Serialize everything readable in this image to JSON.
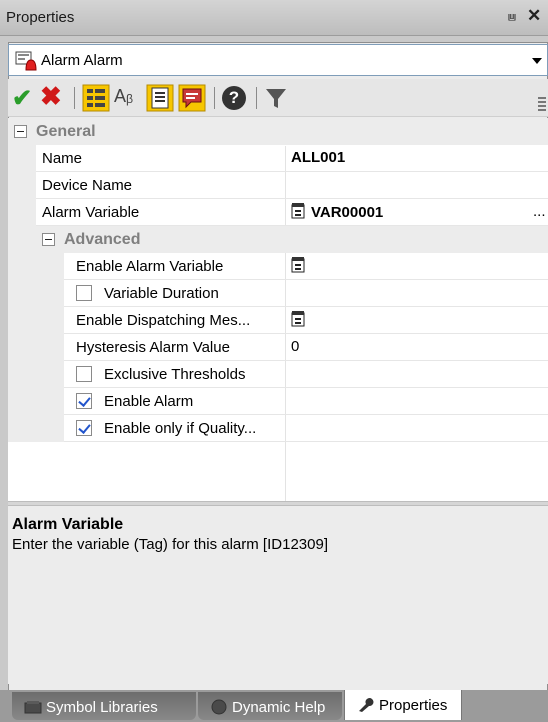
{
  "panel": {
    "title": "Properties",
    "pin_glyph": "⩏",
    "close_glyph": "✕"
  },
  "selector": {
    "value": "Alarm Alarm",
    "icon": "alarm-object-icon"
  },
  "toolbar": {
    "buttons": [
      {
        "name": "apply-icon",
        "glyph": "✔"
      },
      {
        "name": "cancel-icon",
        "glyph": "✖"
      },
      {
        "name": "categorized-icon"
      },
      {
        "name": "alphabetical-icon",
        "glyph": "Aᵦ"
      },
      {
        "name": "property-pages-icon"
      },
      {
        "name": "comment-icon"
      },
      {
        "name": "help-icon",
        "glyph": "?"
      },
      {
        "name": "filter-icon"
      }
    ]
  },
  "grid": {
    "category_general": "General",
    "name_label": "Name",
    "name_value": "ALL001",
    "device_label": "Device Name",
    "device_value": "",
    "alarm_var_label": "Alarm Variable",
    "alarm_var_value": "VAR00001",
    "alarm_var_button": "...",
    "category_advanced": "Advanced",
    "enable_var_label": "Enable Alarm Variable",
    "var_duration_label": "Variable Duration",
    "var_duration_checked": false,
    "enable_dispatch_label": "Enable Dispatching Mes...",
    "hysteresis_label": "Hysteresis Alarm Value",
    "hysteresis_value": "0",
    "exclusive_label": "Exclusive Thresholds",
    "exclusive_checked": false,
    "enable_alarm_label": "Enable Alarm",
    "enable_alarm_checked": true,
    "enable_quality_label": "Enable only if Quality...",
    "enable_quality_checked": true
  },
  "description": {
    "heading": "Alarm Variable",
    "body": "Enter the variable (Tag) for this alarm [ID12309]"
  },
  "tabs": [
    {
      "label": "Symbol Libraries",
      "active": false
    },
    {
      "label": "Dynamic Help",
      "active": false
    },
    {
      "label": "Properties",
      "active": true
    }
  ],
  "colors": {
    "accent_blue": "#2255cc",
    "apply_green": "#2a9d2a",
    "cancel_red": "#d01818",
    "highlight_yellow": "#f7c600"
  }
}
